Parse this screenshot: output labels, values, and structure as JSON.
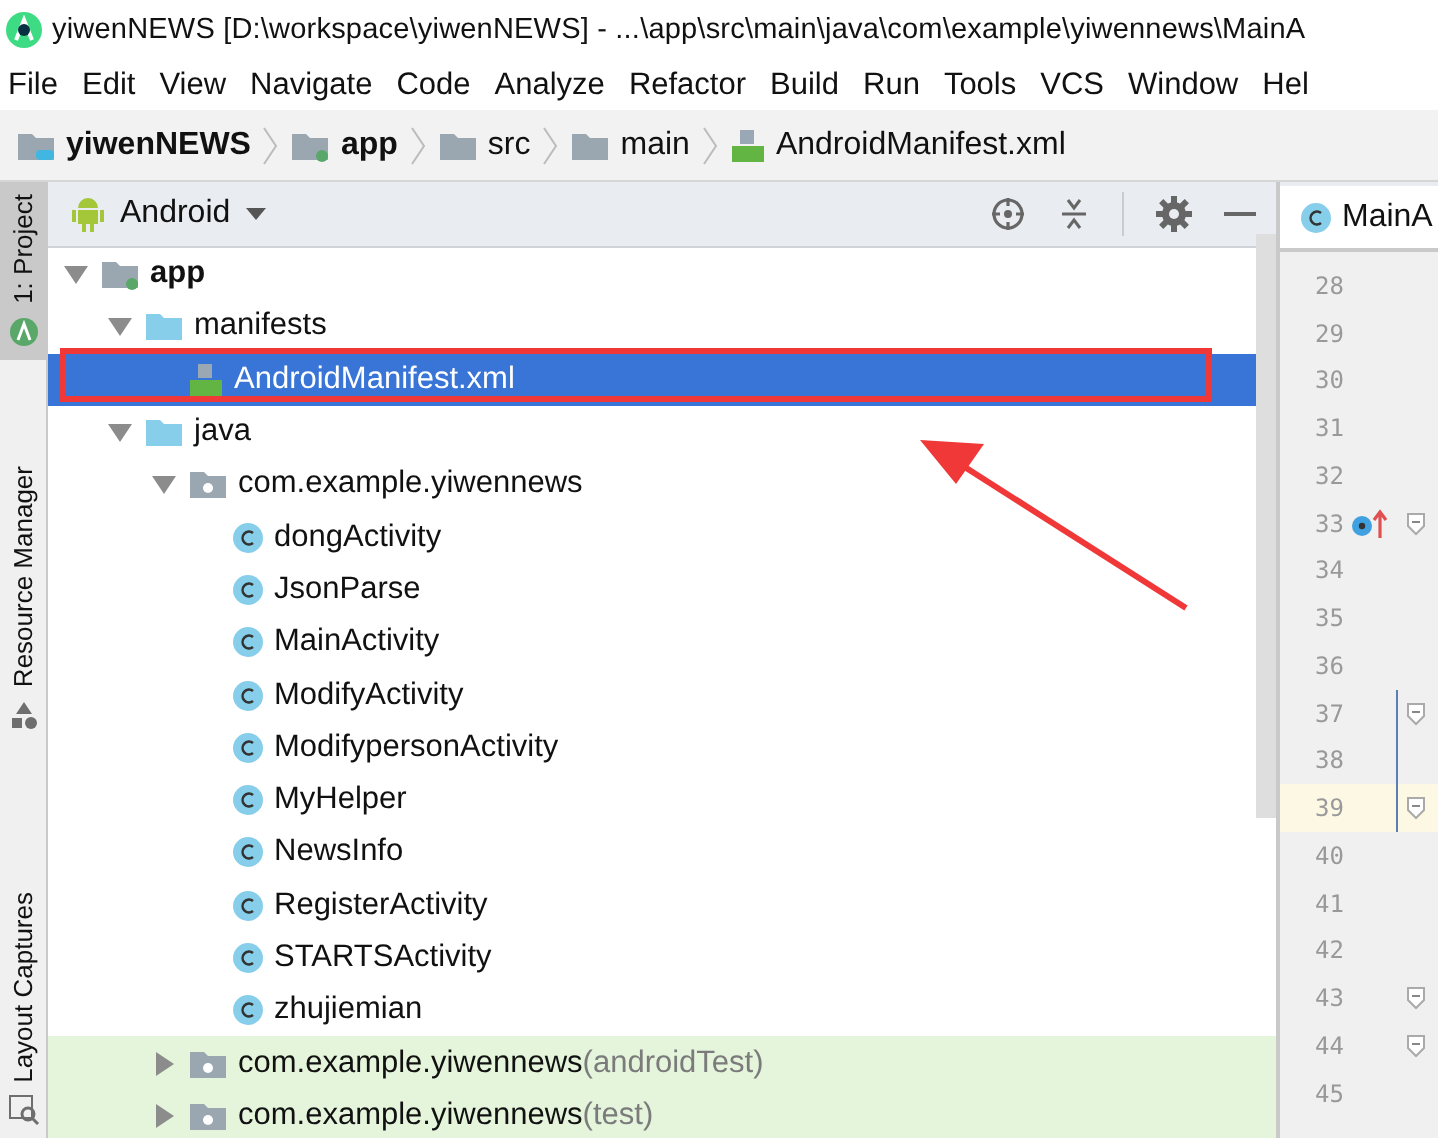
{
  "window": {
    "title": "yiwenNEWS [D:\\workspace\\yiwenNEWS] - ...\\app\\src\\main\\java\\com\\example\\yiwennews\\MainA"
  },
  "menu": [
    "File",
    "Edit",
    "View",
    "Navigate",
    "Code",
    "Analyze",
    "Refactor",
    "Build",
    "Run",
    "Tools",
    "VCS",
    "Window",
    "Hel"
  ],
  "breadcrumb": [
    {
      "label": "yiwenNEWS",
      "kind": "project"
    },
    {
      "label": "app",
      "kind": "module"
    },
    {
      "label": "src",
      "kind": "folder"
    },
    {
      "label": "main",
      "kind": "folder"
    },
    {
      "label": "AndroidManifest.xml",
      "kind": "manifest"
    }
  ],
  "tool_strip": [
    {
      "label": "1: Project",
      "selected": true,
      "kind": "android"
    },
    {
      "label": "Resource Manager",
      "selected": false,
      "kind": "resources"
    },
    {
      "label": "Layout Captures",
      "selected": false,
      "kind": "layout"
    }
  ],
  "project_panel": {
    "view": "Android",
    "tree": [
      {
        "label": "app",
        "kind": "module",
        "selected": false,
        "expanded": true,
        "children": [
          {
            "label": "manifests",
            "kind": "folder",
            "selected": false,
            "expanded": true,
            "children": [
              {
                "label": "AndroidManifest.xml",
                "kind": "manifest",
                "selected": true
              }
            ]
          },
          {
            "label": "java",
            "kind": "folder",
            "selected": false,
            "expanded": true,
            "children": [
              {
                "label": "com.example.yiwennews",
                "kind": "package",
                "selected": false,
                "expanded": true,
                "children": [
                  {
                    "label": "dongActivity",
                    "kind": "class",
                    "selected": false
                  },
                  {
                    "label": "JsonParse",
                    "kind": "class",
                    "selected": false
                  },
                  {
                    "label": "MainActivity",
                    "kind": "class",
                    "selected": false
                  },
                  {
                    "label": "ModifyActivity",
                    "kind": "class",
                    "selected": false
                  },
                  {
                    "label": "ModifypersonActivity",
                    "kind": "class",
                    "selected": false
                  },
                  {
                    "label": "MyHelper",
                    "kind": "class",
                    "selected": false
                  },
                  {
                    "label": "NewsInfo",
                    "kind": "class",
                    "selected": false
                  },
                  {
                    "label": "RegisterActivity",
                    "kind": "class",
                    "selected": false
                  },
                  {
                    "label": "STARTSActivity",
                    "kind": "class",
                    "selected": false
                  },
                  {
                    "label": "zhujiemian",
                    "kind": "class",
                    "selected": false
                  }
                ]
              },
              {
                "label": "com.example.yiwennews",
                "suffix": "(androidTest)",
                "kind": "test-package",
                "selected": false,
                "expanded": false
              },
              {
                "label": "com.example.yiwennews",
                "suffix": "(test)",
                "kind": "test-package",
                "selected": false,
                "expanded": false
              }
            ]
          }
        ]
      }
    ]
  },
  "editor": {
    "tab": "MainA",
    "lines": [
      {
        "number": "28",
        "current": false,
        "fold": false,
        "override": false,
        "scope": false
      },
      {
        "number": "29",
        "current": false,
        "fold": false,
        "override": false,
        "scope": false
      },
      {
        "number": "30",
        "current": false,
        "fold": false,
        "override": false,
        "scope": false
      },
      {
        "number": "31",
        "current": false,
        "fold": false,
        "override": false,
        "scope": false
      },
      {
        "number": "32",
        "current": false,
        "fold": false,
        "override": false,
        "scope": false
      },
      {
        "number": "33",
        "current": false,
        "fold": true,
        "override": true,
        "scope": false
      },
      {
        "number": "34",
        "current": false,
        "fold": false,
        "override": false,
        "scope": false
      },
      {
        "number": "35",
        "current": false,
        "fold": false,
        "override": false,
        "scope": false
      },
      {
        "number": "36",
        "current": false,
        "fold": false,
        "override": false,
        "scope": false
      },
      {
        "number": "37",
        "current": false,
        "fold": true,
        "override": false,
        "scope": true
      },
      {
        "number": "38",
        "current": false,
        "fold": false,
        "override": false,
        "scope": true
      },
      {
        "number": "39",
        "current": true,
        "fold": true,
        "override": false,
        "scope": true
      },
      {
        "number": "40",
        "current": false,
        "fold": false,
        "override": false,
        "scope": false
      },
      {
        "number": "41",
        "current": false,
        "fold": false,
        "override": false,
        "scope": false
      },
      {
        "number": "42",
        "current": false,
        "fold": false,
        "override": false,
        "scope": false
      },
      {
        "number": "43",
        "current": false,
        "fold": true,
        "override": false,
        "scope": false
      },
      {
        "number": "44",
        "current": false,
        "fold": true,
        "override": false,
        "scope": false
      },
      {
        "number": "45",
        "current": false,
        "fold": false,
        "override": false,
        "scope": false
      }
    ]
  }
}
